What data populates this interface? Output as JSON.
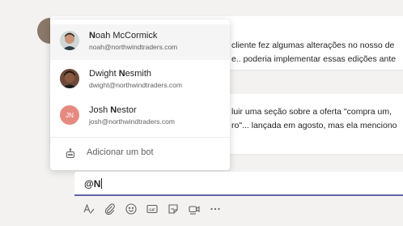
{
  "messages": [
    {
      "text_line1": "cliente fez algumas alterações no nosso de",
      "text_line2": "e.. poderia implementar essas edições ante"
    },
    {
      "text_line1": "luir uma seção sobre a oferta \"compra um,",
      "text_line2": "ro\"... lançada em agosto, mas ela menciono"
    }
  ],
  "mention_popup": {
    "people": [
      {
        "name_bold": "N",
        "name_rest": "oah McCormick",
        "name_pre": "",
        "email": "noah@northwindtraders.com",
        "avatar": "photo"
      },
      {
        "name_pre": "Dwight ",
        "name_bold": "N",
        "name_rest": "esmith",
        "email": "dwight@northwindtraders.com",
        "avatar": "photo"
      },
      {
        "name_pre": "Josh ",
        "name_bold": "N",
        "name_rest": "estor",
        "email": "josh@northwindtraders.com",
        "avatar": "initials",
        "initials": "JN",
        "avatar_color": "#e68a80"
      }
    ],
    "add_bot_label": "Adicionar um bot",
    "add_bot_icon": "bot-icon"
  },
  "compose": {
    "value": "@N"
  },
  "toolbar_icons": [
    "format-icon",
    "attach-icon",
    "emoji-icon",
    "gif-icon",
    "sticker-icon",
    "meet-now-icon",
    "more-options-icon"
  ],
  "colors": {
    "accent": "#6264a7",
    "background": "#f3f2f1",
    "highlight": "#f5f5f5"
  }
}
